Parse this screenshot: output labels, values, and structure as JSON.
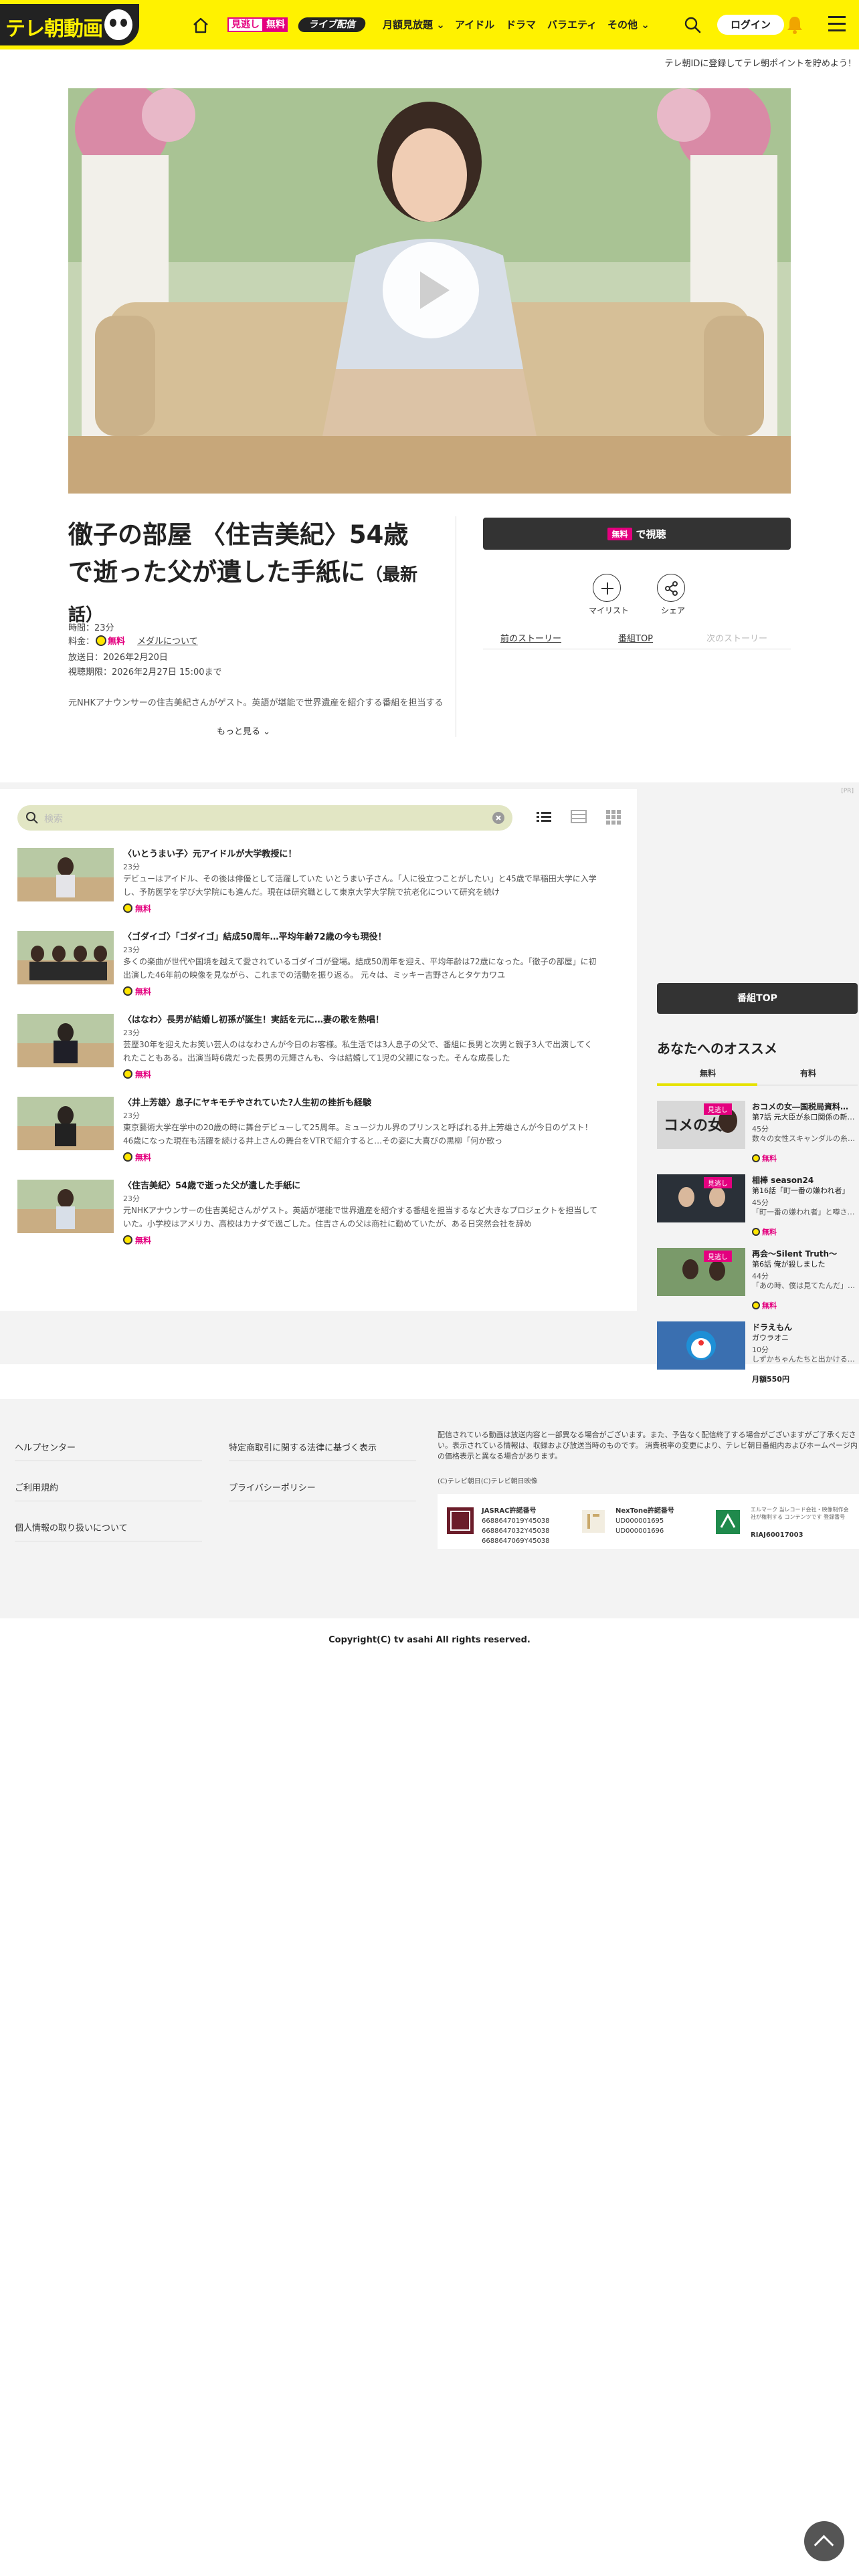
{
  "header": {
    "logo": "テレ朝動画",
    "mitoshi_a": "見逃し",
    "mitoshi_b": "無料",
    "live": "ライブ配信",
    "nav": [
      {
        "label": "月額見放題"
      },
      {
        "label": "アイドル"
      },
      {
        "label": "ドラマ"
      },
      {
        "label": "バラエティ"
      },
      {
        "label": "その他"
      }
    ],
    "login": "ログイン",
    "notice": "テレ朝IDに登録してテレ朝ポイントを貯めよう！",
    "accent": "#fff200"
  },
  "episode": {
    "title": "徹子の部屋 〈住吉美紀〉54歳で逝った父が遺した手紙に",
    "latest": "（最新話）",
    "duration": "時間：23分",
    "fee_label": "料金：",
    "fee_free": "無料",
    "medal_link": "メダルについて",
    "aired": "放送日：2026年2月20日",
    "deadline": "視聴期限：2026年2月27日 15:00まで",
    "desc": "元NHKアナウンサーの住吉美紀さんがゲスト。英語が堪能で世界遺産を紹介する番組を担当するなど",
    "more": "もっと見る",
    "watch_free": "無料",
    "watch_label": "で視聴",
    "mylist": "マイリスト",
    "share": "シェア",
    "prev": "前のストーリー",
    "top": "番組TOP",
    "next": "次のストーリー"
  },
  "list": {
    "search_placeholder": "検索",
    "ad": "[PR]",
    "episodes": [
      {
        "title": "〈いとうまい子〉元アイドルが大学教授に！",
        "dur": "23分",
        "summary": "デビューはアイドル、その後は俳優として活躍していた いとうまい子さん。「人に役立つことがしたい」と45歳で早稲田大学に入学し、予防医学を学び大学院にも進んだ。現在は研究職として東京大学大学院で抗老化について研究を続け",
        "free": "無料"
      },
      {
        "title": "〈ゴダイゴ〉「ゴダイゴ」結成50周年…平均年齢72歳の今も現役！",
        "dur": "23分",
        "summary": "多くの楽曲が世代や国境を越えて愛されているゴダイゴが登場。結成50周年を迎え、平均年齢は72歳になった。「徹子の部屋」に初出演した46年前の映像を見ながら、これまでの活動を振り返る。 元々は、ミッキー吉野さんとタケカワユ",
        "free": "無料"
      },
      {
        "title": "〈はなわ〉長男が結婚し初孫が誕生！実話を元に…妻の歌を熱唱！",
        "dur": "23分",
        "summary": "芸歴30年を迎えたお笑い芸人のはなわさんが今日のお客様。私生活では3人息子の父で、番組に長男と次男と親子3人で出演してくれたこともある。出演当時6歳だった長男の元輝さんも、今は結婚して1児の父親になった。そんな成長した",
        "free": "無料"
      },
      {
        "title": "〈井上芳雄〉息子にヤキモチやされていた?人生初の挫折も経験",
        "dur": "23分",
        "summary": "東京藝術大学在学中の20歳の時に舞台デビューして25周年。ミュージカル界のプリンスと呼ばれる井上芳雄さんが今日のゲスト！46歳になった現在も活躍を続ける井上さんの舞台をVTRで紹介すると…その姿に大喜びの黒柳「何か歌っ",
        "free": "無料"
      },
      {
        "title": "〈住吉美紀〉54歳で逝った父が遺した手紙に",
        "dur": "23分",
        "summary": "元NHKアナウンサーの住吉美紀さんがゲスト。英語が堪能で世界遺産を紹介する番組を担当するなど大きなプロジェクトを担当していた。小学校はアメリカ、高校はカナダで過ごした。住吉さんの父は商社に勤めていたが、ある日突然会社を辞め",
        "free": "無料"
      }
    ]
  },
  "sidebar": {
    "program_top": "番組TOP",
    "rec_title": "あなたへのオススメ",
    "tab_free": "無料",
    "tab_paid": "有料",
    "items": [
      {
        "tag": "見逃し",
        "title": "おコメの女―国税局資料…",
        "ep": "第7話 元大臣が糸口関係の新…",
        "min": "45分",
        "extra": "数々の女性スキャンダルの糸…",
        "free": "無料"
      },
      {
        "tag": "見逃し",
        "title": "相棒 season24",
        "ep": "第16話「町一番の嫌われ者」",
        "min": "45分",
        "extra": "「町一番の嫌われ者」と噂さ…",
        "free": "無料"
      },
      {
        "tag": "見逃し",
        "title": "再会～Silent Truth～",
        "ep": "第6話 俺が殺しました",
        "min": "44分",
        "extra": "「あの時、僕は見てたんだ」…",
        "free": "無料"
      },
      {
        "tag": "",
        "title": "ドラえもん",
        "ep": "ガウラオニ",
        "min": "10分",
        "extra": "しずかちゃんたちと出かける…",
        "price": "月額550円"
      }
    ]
  },
  "footer": {
    "links": [
      "ヘルプセンター",
      "ご利用規約",
      "個人情報の取り扱いについて",
      "特定商取引に関する法律に基づく表示",
      "プライバシーポリシー"
    ],
    "note": "配信されている動画は放送内容と一部異なる場合がございます。また、予告なく配信終了する場合がございますがご了承ください。表示されている情報は、収録および放送当時のものです。 消費税率の変更により、テレビ朝日番組内およびホームページ内の価格表示と異なる場合があります。",
    "copy_small": "(C)テレビ朝日(C)テレビ朝日映像",
    "jasrac_title": "JASRAC許諾番号",
    "jasrac_nums": [
      "6688647019Y45038",
      "6688647032Y45038",
      "6688647069Y45038"
    ],
    "nextone_title": "NexTone許諾番号",
    "nextone_nums": [
      "UD000001695",
      "UD000001696"
    ],
    "riaj_text": "エルマーク 当レコード会社・映像制作会社が権利する コンテンツです 登録番号",
    "riaj_num": "RIAJ60017003",
    "copyright": "Copyright(C) tv asahi All rights reserved."
  }
}
